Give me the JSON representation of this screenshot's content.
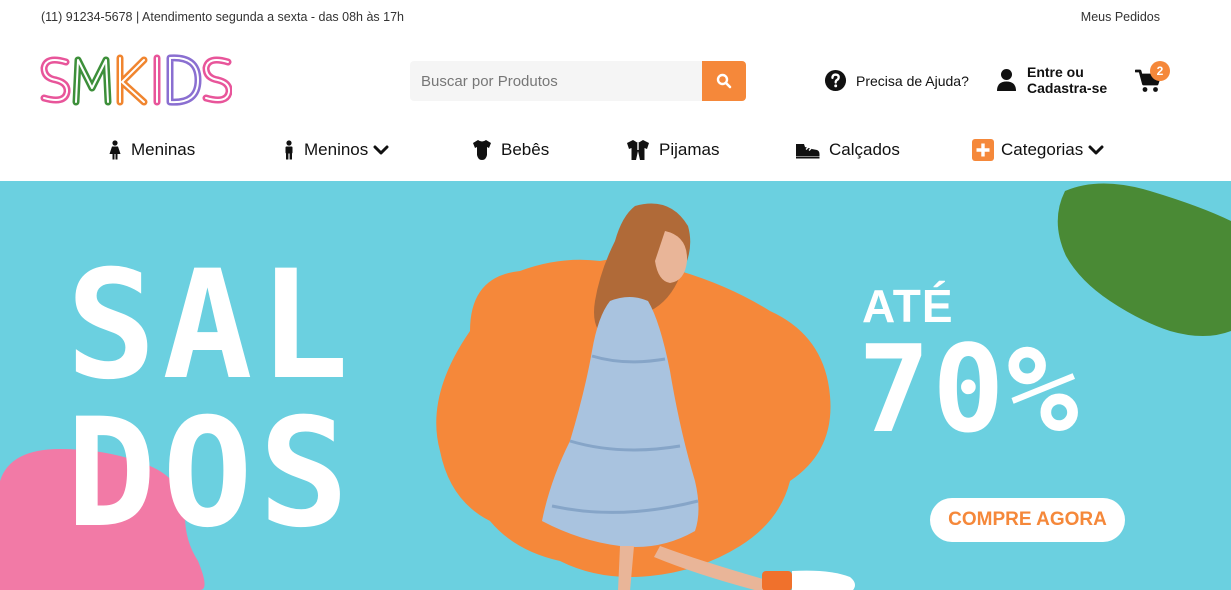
{
  "topbar": {
    "contact": "(11) 91234-5678 | Atendimento segunda a sexta - das 08h às 17h",
    "orders_link": "Meus Pedidos"
  },
  "header": {
    "logo_text": "SMKIDS",
    "logo_colors": [
      "#e8559a",
      "#3d8f3a",
      "#f0852f",
      "#e8559a",
      "#8a6fd1",
      "#e8559a"
    ],
    "search": {
      "placeholder": "Buscar por Produtos",
      "value": "",
      "icon": "search-icon"
    },
    "help": {
      "label": "Precisa de Ajuda?",
      "icon": "question-circle-icon"
    },
    "account": {
      "line1": "Entre ou",
      "line2": "Cadastra-se",
      "icon": "user-icon"
    },
    "cart": {
      "count": "2",
      "icon": "cart-icon"
    }
  },
  "nav": {
    "items": [
      {
        "label": "Meninas",
        "icon": "girl-icon"
      },
      {
        "label": "Meninos",
        "icon": "boy-icon",
        "dropdown": true
      },
      {
        "label": "Bebês",
        "icon": "onesie-icon"
      },
      {
        "label": "Pijamas",
        "icon": "pajama-icon"
      },
      {
        "label": "Calçados",
        "icon": "shoe-icon"
      },
      {
        "label": "Categorias",
        "icon": "plus-square-icon",
        "dropdown": true
      }
    ]
  },
  "banner": {
    "line1": "SAL",
    "line2": "DOS",
    "ate": "ATÉ",
    "percent": "70%",
    "cta": "COMPRE AGORA",
    "colors": {
      "background": "#6bd0e0",
      "orange": "#f5883a",
      "pink": "#f27aa6",
      "green": "#4a8a35",
      "white": "#ffffff"
    }
  }
}
